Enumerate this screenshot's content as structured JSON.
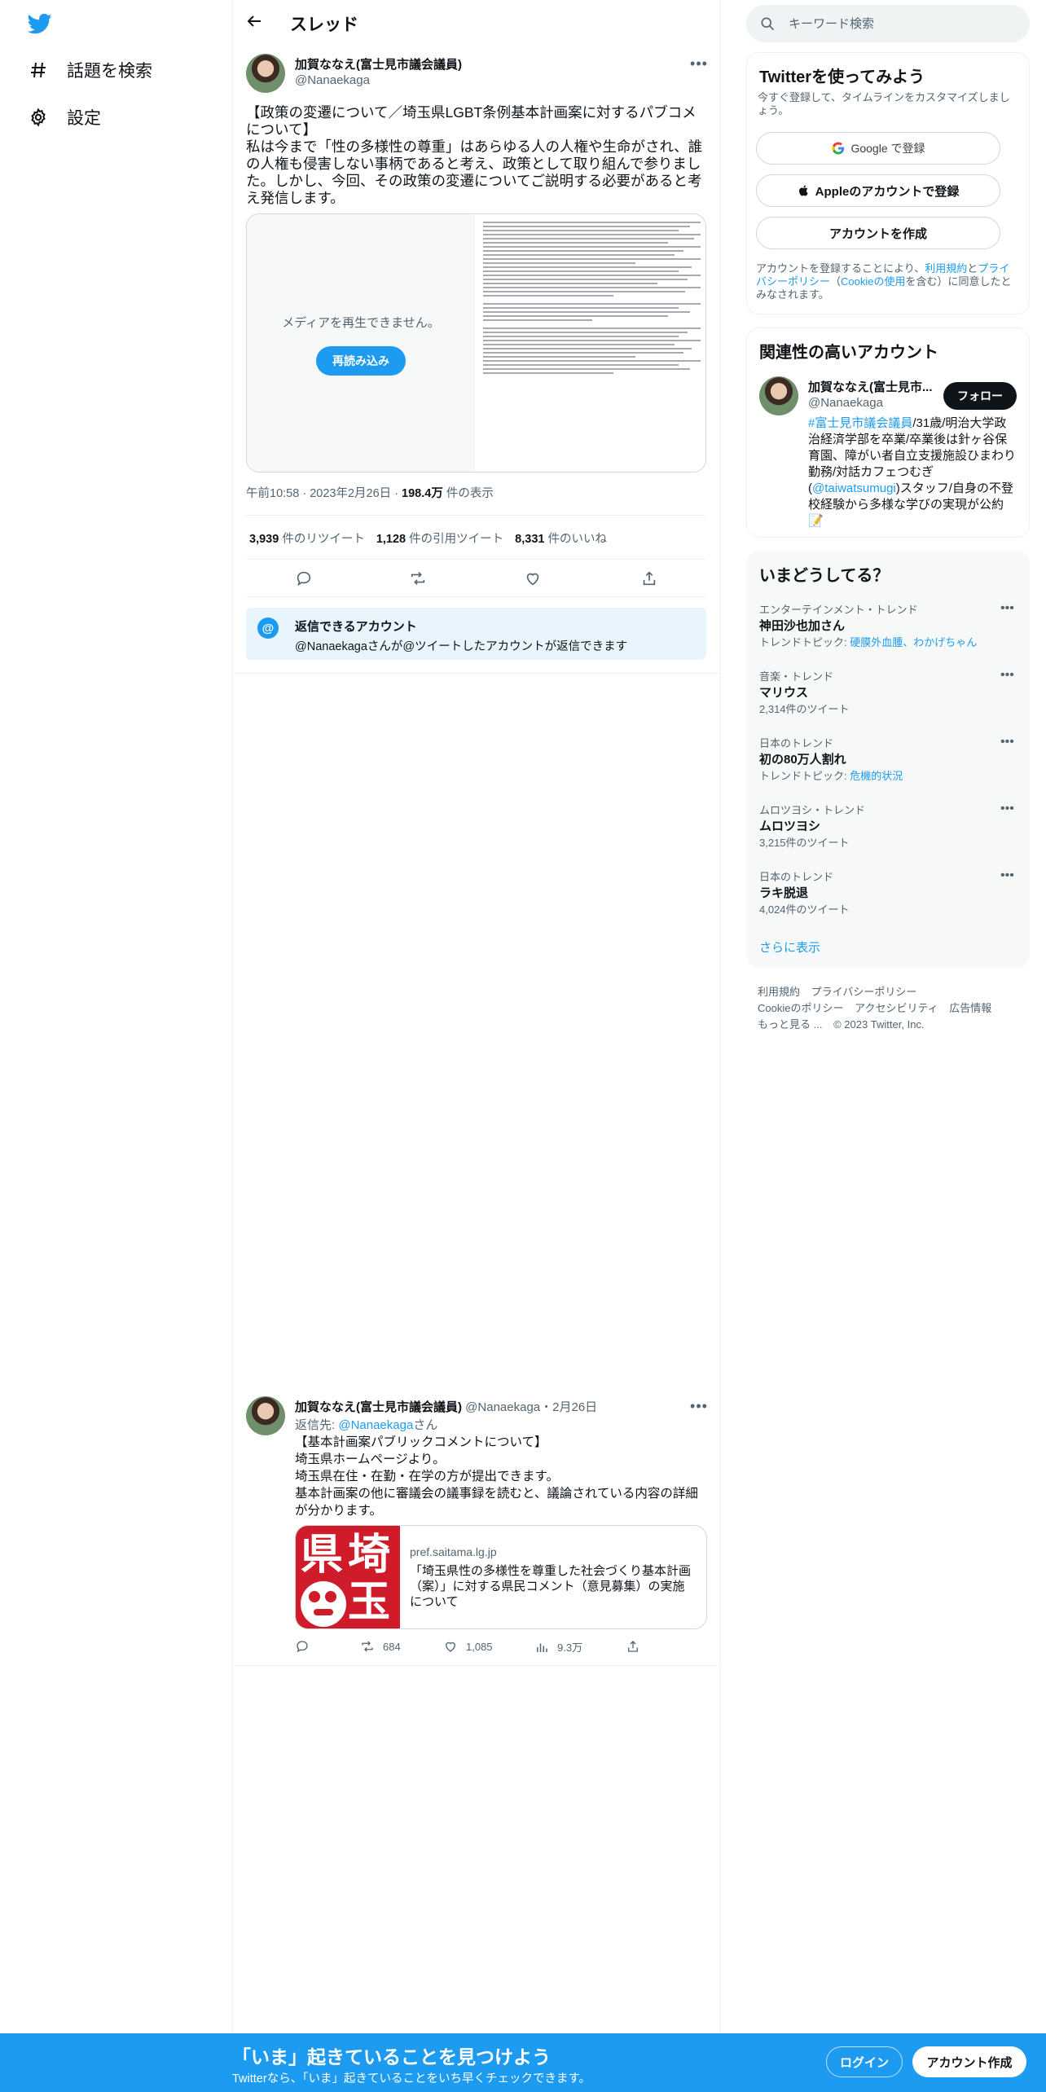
{
  "nav": {
    "explore_label": "話題を検索",
    "settings_label": "設定"
  },
  "header": {
    "title": "スレッド"
  },
  "tweet": {
    "author_name": "加賀ななえ(富士見市議会議員)",
    "author_handle": "@Nanaekaga",
    "text": "【政策の変遷について／埼玉県LGBT条例基本計画案に対するパブコメについて】\n私は今まで「性の多様性の尊重」はあらゆる人の人権や生命がされ、誰の人権も侵害しない事柄であると考え、政策として取り組んで参りました。しかし、今回、その政策の変遷についてご説明する必要があると考え発信します。",
    "media_message": "メディアを再生できません。",
    "media_reload": "再読み込み",
    "time": "午前10:58",
    "date": "2023年2月26日",
    "views_count": "198.4万",
    "views_label": "件の表示",
    "retweets_count": "3,939",
    "retweets_label": "件のリツイート",
    "quotes_count": "1,128",
    "quotes_label": "件の引用ツイート",
    "likes_count": "8,331",
    "likes_label": "件のいいね"
  },
  "reply_notice": {
    "title": "返信できるアカウント",
    "description": "@Nanaekagaさんが@ツイートしたアカウントが返信できます"
  },
  "tweet2": {
    "author_name": "加賀ななえ(富士見市議会議員)",
    "author_handle": "@Nanaekaga",
    "date": "・2月26日",
    "reply_prefix": "返信先: ",
    "reply_to": "@Nanaekaga",
    "reply_suffix": "さん",
    "lines": [
      "【基本計画案パブリックコメントについて】",
      "埼玉県ホームページより。",
      "埼玉県在住・在勤・在学の方が提出できます。",
      "基本計画案の他に審議会の議事録を読むと、議論されている内容の詳細が分かります。"
    ],
    "card_thumb_chars": [
      "県",
      "埼",
      "玉"
    ],
    "card_domain": "pref.saitama.lg.jp",
    "card_title": "「埼玉県性の多様性を尊重した社会づくり基本計画（案）」に対する県民コメント（意見募集）の実施について",
    "retweets": "684",
    "likes": "1,085",
    "views": "9.3万"
  },
  "search": {
    "placeholder": "キーワード検索"
  },
  "signup_panel": {
    "title": "Twitterを使ってみよう",
    "subtitle": "今すぐ登録して、タイムラインをカスタマイズしましょう。",
    "google_label": "Google で登録",
    "apple_label": "Appleのアカウントで登録",
    "create_label": "アカウントを作成",
    "terms_pre": "アカウントを登録することにより、",
    "terms_link1": "利用規約",
    "terms_mid1": "と",
    "terms_link2": "プライバシーポリシー",
    "terms_mid2": "（",
    "terms_link3": "Cookieの使用",
    "terms_post": "を含む）に同意したとみなされます。"
  },
  "relevant": {
    "title": "関連性の高いアカウント",
    "name": "加賀ななえ(富士見市...",
    "handle": "@Nanaekaga",
    "follow_label": "フォロー",
    "bio_link1": "#富士見市議会議員",
    "bio_text1": "/31歳/明治大学政治経済学部を卒業/卒業後は針ヶ谷保育園、障がい者自立支援施設ひまわり勤務/対話カフェつむぎ(",
    "bio_link2": "@taiwatsumugi",
    "bio_text2": ")スタッフ/自身の不登校経験から多様な学びの実現が公約📝"
  },
  "trends": {
    "title": "いまどうしてる？",
    "items": [
      {
        "category": "エンターテインメント・トレンド",
        "name": "神田沙也加さん",
        "topic_prefix": "トレンドトピック: ",
        "topic": "硬膜外血腫、わかげちゃん"
      },
      {
        "category": "音楽・トレンド",
        "name": "マリウス",
        "count": "2,314件のツイート"
      },
      {
        "category": "日本のトレンド",
        "name": "初の80万人割れ",
        "topic_prefix": "トレンドトピック: ",
        "topic": "危機的状況"
      },
      {
        "category": "ムロツヨシ・トレンド",
        "name": "ムロツヨシ",
        "count": "3,215件のツイート"
      },
      {
        "category": "日本のトレンド",
        "name": "ラキ脱退",
        "count": "4,024件のツイート"
      }
    ],
    "show_more": "さらに表示"
  },
  "footer": {
    "links": [
      "利用規約",
      "プライバシーポリシー",
      "Cookieのポリシー",
      "アクセシビリティ",
      "広告情報",
      "もっと見る ...",
      "© 2023 Twitter, Inc."
    ]
  },
  "bottom_bar": {
    "title": "「いま」起きていることを見つけよう",
    "subtitle": "Twitterなら、「いま」起きていることをいち早くチェックできます。",
    "login_label": "ログイン",
    "create_label": "アカウント作成"
  },
  "colors": {
    "brand": "#1d9bf0",
    "text": "#0f1419",
    "secondary": "#536471"
  }
}
